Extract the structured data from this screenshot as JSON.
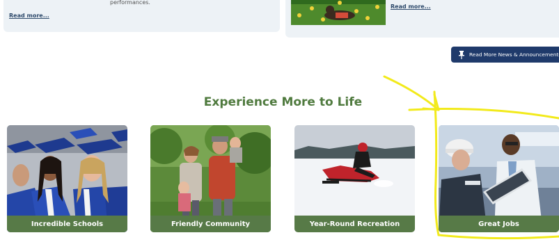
{
  "news": {
    "left_snippet": "performances.",
    "left_read_more": "Read more...",
    "right_read_more": "Read more..."
  },
  "announcements_button": {
    "label": "Read More News & Announcements",
    "icon": "pin-icon"
  },
  "section": {
    "title": "Experience More to Life"
  },
  "cards": [
    {
      "label": "Incredible Schools",
      "image": "graduates-photo"
    },
    {
      "label": "Friendly Community",
      "image": "family-orchard-photo"
    },
    {
      "label": "Year-Round Recreation",
      "image": "snowmobile-photo"
    },
    {
      "label": "Great Jobs",
      "image": "engineers-photo"
    }
  ],
  "colors": {
    "heading_green": "#4f7a3e",
    "card_label_green": "#577a47",
    "button_navy": "#1f3a6b",
    "card_bg": "#edf2f6",
    "annotation_yellow": "#f2ea1b"
  }
}
